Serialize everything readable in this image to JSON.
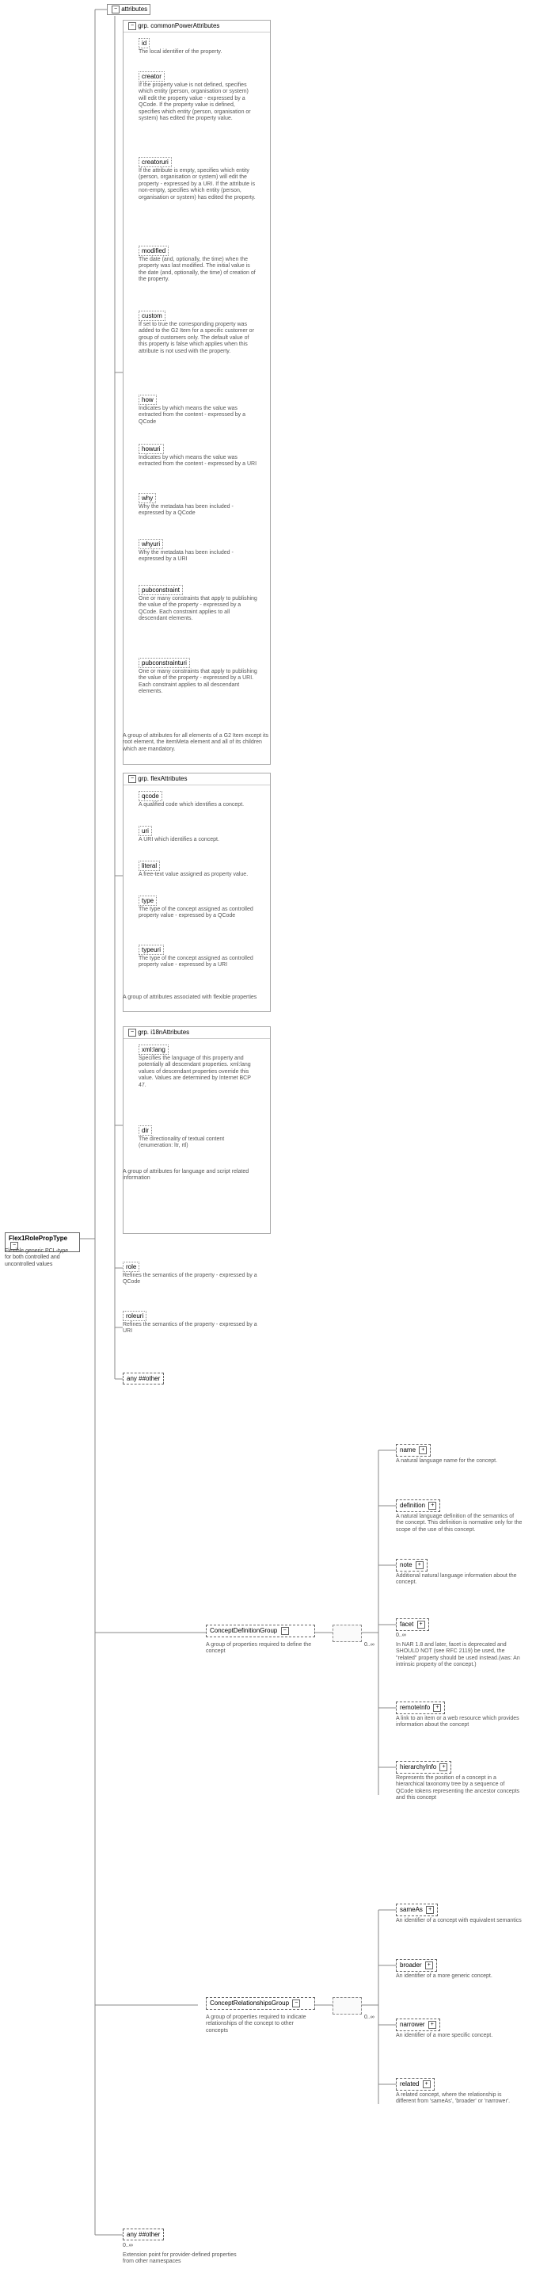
{
  "root": {
    "name": "Flex1RolePropType",
    "desc": "Flexible generic PCL-type for both controlled and uncontrolled values"
  },
  "attributesLabel": "attributes",
  "groups": {
    "commonPower": {
      "label": "grp. commonPowerAttributes",
      "items": [
        {
          "name": "id",
          "desc": "The local identifier of the property."
        },
        {
          "name": "creator",
          "desc": "If the property value is not defined, specifies which entity (person, organisation or system) will edit the property value - expressed by a QCode. If the property value is defined, specifies which entity (person, organisation or system) has edited the property value."
        },
        {
          "name": "creatoruri",
          "desc": "If the attribute is empty, specifies which entity (person, organisation or system) will edit the property - expressed by a URI. If the attribute is non-empty, specifies which entity (person, organisation or system) has edited the property."
        },
        {
          "name": "modified",
          "desc": "The date (and, optionally, the time) when the property was last modified. The initial value is the date (and, optionally, the time) of creation of the property."
        },
        {
          "name": "custom",
          "desc": "If set to true the corresponding property was added to the G2 Item for a specific customer or group of customers only. The default value of this property is false which applies when this attribute is not used with the property."
        },
        {
          "name": "how",
          "desc": "Indicates by which means the value was extracted from the content - expressed by a QCode"
        },
        {
          "name": "howuri",
          "desc": "Indicates by which means the value was extracted from the content - expressed by a URI"
        },
        {
          "name": "why",
          "desc": "Why the metadata has been included - expressed by a QCode"
        },
        {
          "name": "whyuri",
          "desc": "Why the metadata has been included - expressed by a URI"
        },
        {
          "name": "pubconstraint",
          "desc": "One or many constraints that apply to publishing the value of the property - expressed by a QCode. Each constraint applies to all descendant elements."
        },
        {
          "name": "pubconstrainturi",
          "desc": "One or many constraints that apply to publishing the value of the property - expressed by a URI. Each constraint applies to all descendant elements."
        }
      ],
      "footer": "A group of attributes for all elements of a G2 Item except its root element, the itemMeta element and all of its children which are mandatory."
    },
    "flexAttrs": {
      "label": "grp. flexAttributes",
      "items": [
        {
          "name": "qcode",
          "desc": "A qualified code which identifies a concept."
        },
        {
          "name": "uri",
          "desc": "A URI which identifies a concept."
        },
        {
          "name": "literal",
          "desc": "A free-text value assigned as property value."
        },
        {
          "name": "type",
          "desc": "The type of the concept assigned as controlled property value - expressed by a QCode"
        },
        {
          "name": "typeuri",
          "desc": "The type of the concept assigned as controlled property value - expressed by a URI"
        }
      ],
      "footer": "A group of attributes associated with flexible properties"
    },
    "i18n": {
      "label": "grp. i18nAttributes",
      "items": [
        {
          "name": "xml:lang",
          "desc": "Specifies the language of this property and potentially all descendant properties. xml:lang values of descendant properties override this value. Values are determined by Internet BCP 47."
        },
        {
          "name": "dir",
          "desc": "The directionality of textual content (enumeration: ltr, rtl)"
        }
      ],
      "footer": "A group of attributes for language and script related information"
    },
    "role": {
      "name": "role",
      "desc": "Refines the semantics of the property - expressed by a QCode"
    },
    "roleuri": {
      "name": "roleuri",
      "desc": "Refines the semantics of the property - expressed by a URI"
    }
  },
  "anyOther": "any ##other",
  "conceptDef": {
    "label": "ConceptDefinitionGroup",
    "desc": "A group of properties required to define the concept",
    "occ": "0..∞",
    "items": [
      {
        "name": "name",
        "desc": "A natural language name for the concept."
      },
      {
        "name": "definition",
        "desc": "A natural language definition of the semantics of the concept. This definition is normative only for the scope of the use of this concept."
      },
      {
        "name": "note",
        "desc": "Additional natural language information about the concept."
      },
      {
        "name": "facet",
        "desc": "In NAR 1.8 and later, facet is deprecated and SHOULD NOT (see RFC 2119) be used, the \"related\" property should be used instead.(was: An intrinsic property of the concept.)",
        "occ": "0..∞"
      },
      {
        "name": "remoteInfo",
        "desc": "A link to an item or a web resource which provides information about the concept"
      },
      {
        "name": "hierarchyInfo",
        "desc": "Represents the position of a concept in a hierarchical taxonomy tree by a sequence of QCode tokens representing the ancestor concepts and this concept"
      }
    ]
  },
  "conceptRel": {
    "label": "ConceptRelationshipsGroup",
    "desc": "A group of properties required to indicate relationships of the concept to other concepts",
    "occ": "0..∞",
    "items": [
      {
        "name": "sameAs",
        "desc": "An identifier of a concept with equivalent semantics"
      },
      {
        "name": "broader",
        "desc": "An identifier of a more generic concept."
      },
      {
        "name": "narrower",
        "desc": "An identifier of a more specific concept."
      },
      {
        "name": "related",
        "desc": "A related concept, where the relationship is different from 'sameAs', 'broader' or 'narrower'."
      }
    ]
  },
  "anyOtherBottom": {
    "label": "any ##other",
    "desc": "Extension point for provider-defined properties from other namespaces",
    "occ": "0..∞"
  },
  "misc": {
    "seqLabel": "",
    "plus": "+"
  }
}
